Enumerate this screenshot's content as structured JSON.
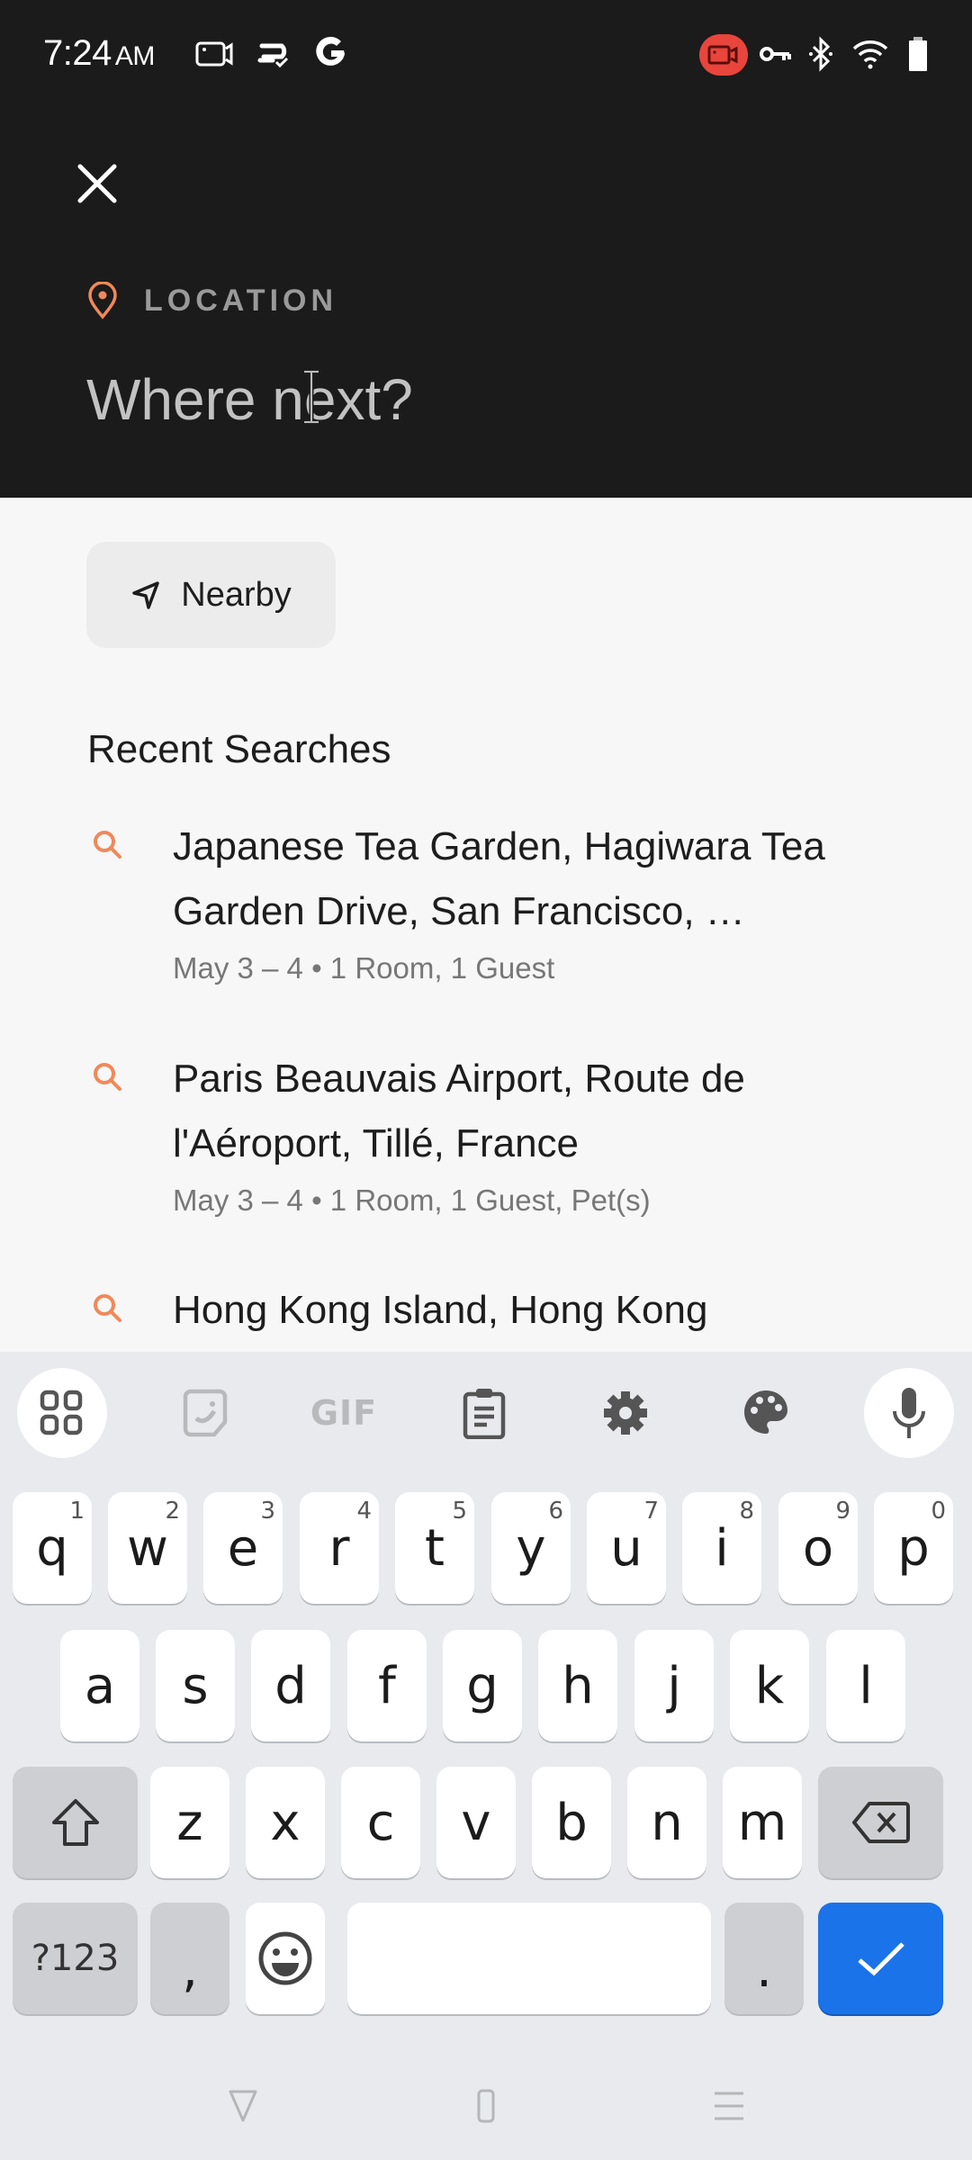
{
  "status_bar": {
    "time": "7:24",
    "ampm": "AM",
    "left_icons": [
      "screen-record-icon",
      "cloud-sync-icon",
      "google-icon"
    ],
    "right_icons": [
      "recording-indicator-icon",
      "vpn-key-icon",
      "bluetooth-icon",
      "wifi-icon",
      "battery-icon"
    ],
    "recording_color": "#e8453c"
  },
  "header": {
    "close_icon": "close-icon",
    "location_icon": "location-pin-icon",
    "location_label": "LOCATION",
    "search_placeholder": "Where next?",
    "search_value": "",
    "accent_color": "#f0895a"
  },
  "nearby": {
    "icon": "navigation-arrow-icon",
    "label": "Nearby"
  },
  "recent": {
    "title": "Recent Searches",
    "items": [
      {
        "title": "Japanese Tea Garden, Hagiwara Tea Garden Drive, San Francisco, …",
        "subtitle": "May 3 – 4 • 1 Room, 1 Guest"
      },
      {
        "title": "Paris Beauvais Airport, Route de l'Aéroport, Tillé, France",
        "subtitle": "May 3 – 4 • 1 Room, 1 Guest, Pet(s)"
      },
      {
        "title": "Hong Kong Island, Hong Kong",
        "subtitle": ""
      }
    ]
  },
  "keyboard": {
    "toolbar": [
      "apps-grid-icon",
      "sticker-icon",
      "gif-icon",
      "clipboard-icon",
      "settings-icon",
      "palette-icon",
      "microphone-icon"
    ],
    "gif_label": "GIF",
    "row1": [
      {
        "k": "q",
        "h": "1"
      },
      {
        "k": "w",
        "h": "2"
      },
      {
        "k": "e",
        "h": "3"
      },
      {
        "k": "r",
        "h": "4"
      },
      {
        "k": "t",
        "h": "5"
      },
      {
        "k": "y",
        "h": "6"
      },
      {
        "k": "u",
        "h": "7"
      },
      {
        "k": "i",
        "h": "8"
      },
      {
        "k": "o",
        "h": "9"
      },
      {
        "k": "p",
        "h": "0"
      }
    ],
    "row2": [
      "a",
      "s",
      "d",
      "f",
      "g",
      "h",
      "j",
      "k",
      "l"
    ],
    "row3": [
      "z",
      "x",
      "c",
      "v",
      "b",
      "n",
      "m"
    ],
    "symbols_label": "?123",
    "comma": ",",
    "period": ".",
    "enter_color": "#1a73e8"
  },
  "nav_bar": [
    "back-icon",
    "home-icon",
    "recents-icon"
  ]
}
